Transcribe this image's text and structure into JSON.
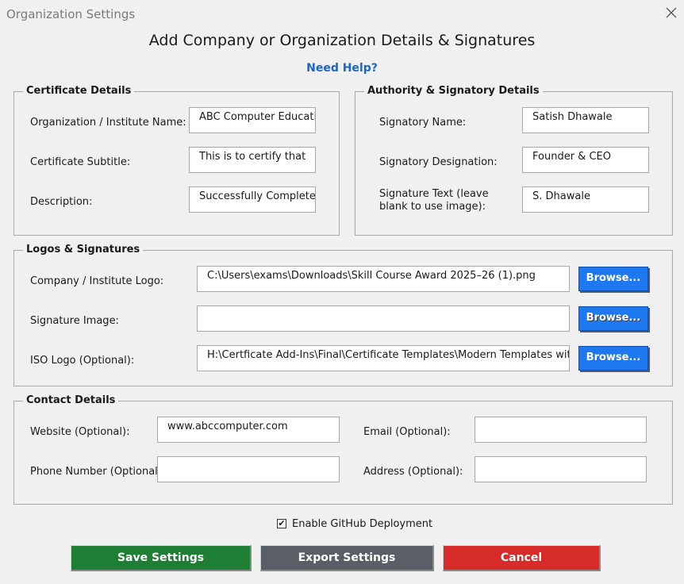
{
  "window": {
    "title": "Organization Settings"
  },
  "header": {
    "title": "Add Company or Organization Details & Signatures",
    "help": "Need Help?"
  },
  "certificate": {
    "title": "Certificate Details",
    "org_label": "Organization / Institute Name:",
    "org_value": "ABC Computer Education",
    "subtitle_label": "Certificate Subtitle:",
    "subtitle_value": "This is to certify that",
    "desc_label": "Description:",
    "desc_value": "Successfully Completed th"
  },
  "authority": {
    "title": "Authority & Signatory Details",
    "name_label": "Signatory Name:",
    "name_value": "Satish Dhawale",
    "designation_label": "Signatory Designation:",
    "designation_value": "Founder & CEO",
    "sigtext_label": "Signature Text (leave blank to use image):",
    "sigtext_value": "S. Dhawale"
  },
  "logos": {
    "title": "Logos & Signatures",
    "company_label": "Company / Institute Logo:",
    "company_value": "C:\\Users\\exams\\Downloads\\Skill Course Award 2025–26 (1).png",
    "signature_label": "Signature Image:",
    "signature_value": "",
    "iso_label": "ISO Logo (Optional):",
    "iso_value": "H:\\Certficate Add-Ins\\Final\\Certificate Templates\\Modern Templates with Fonts",
    "browse_label": "Browse..."
  },
  "contact": {
    "title": "Contact Details",
    "website_label": "Website (Optional):",
    "website_value": "www.abccomputer.com",
    "email_label": "Email (Optional):",
    "email_value": "",
    "phone_label": "Phone Number (Optional):",
    "phone_value": "",
    "address_label": "Address (Optional):",
    "address_value": ""
  },
  "github": {
    "label": "Enable GitHub Deployment",
    "checked": true
  },
  "buttons": {
    "save": "Save Settings",
    "export": "Export Settings",
    "cancel": "Cancel"
  },
  "colors": {
    "save": "#1e7e34",
    "export": "#5a5f66",
    "cancel": "#d62b28",
    "browse": "#1e78f0",
    "link": "#1a66c7"
  }
}
